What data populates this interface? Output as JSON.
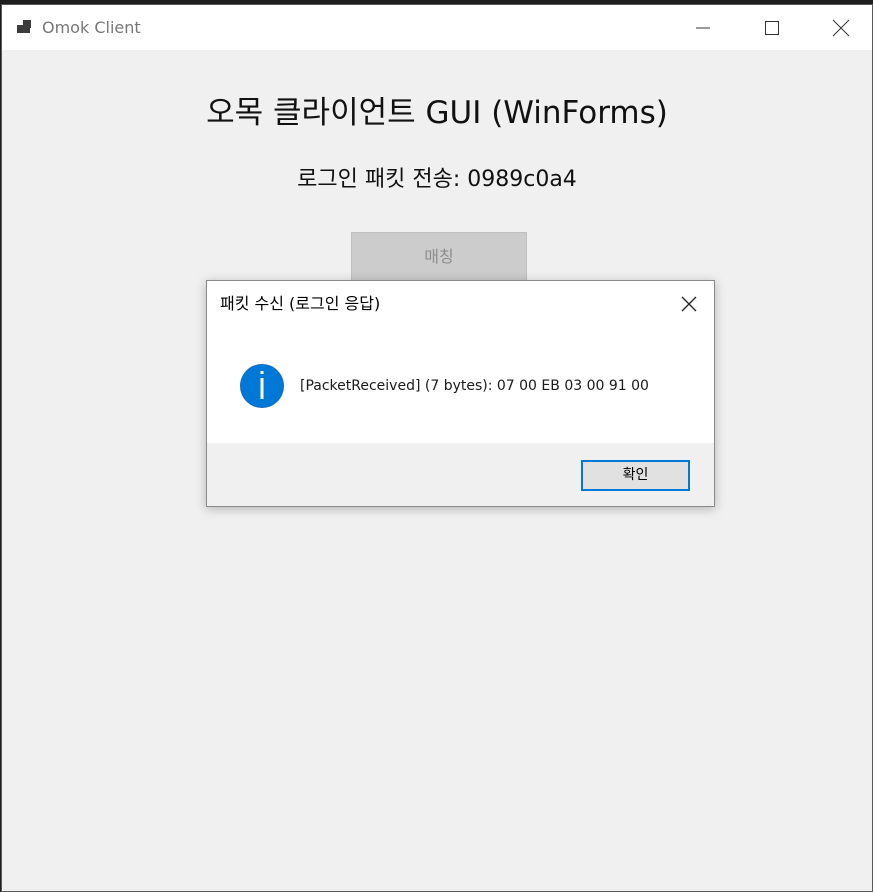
{
  "window": {
    "title": "Omok Client"
  },
  "main": {
    "title": "오목 클라이언트 GUI (WinForms)",
    "login_status": "로그인 패킷 전송: 0989c0a4",
    "match_button_label": "매칭"
  },
  "dialog": {
    "title": "패킷 수신 (로그인 응답)",
    "message": "[PacketReceived] (7 bytes): 07 00 EB 03 00 91 00",
    "ok_label": "확인",
    "icon": "info-icon"
  },
  "colors": {
    "window_bg": "#f0f0f0",
    "info_icon": "#0078d7",
    "focus_border": "#0078d7",
    "disabled_button": "#cccccc"
  }
}
